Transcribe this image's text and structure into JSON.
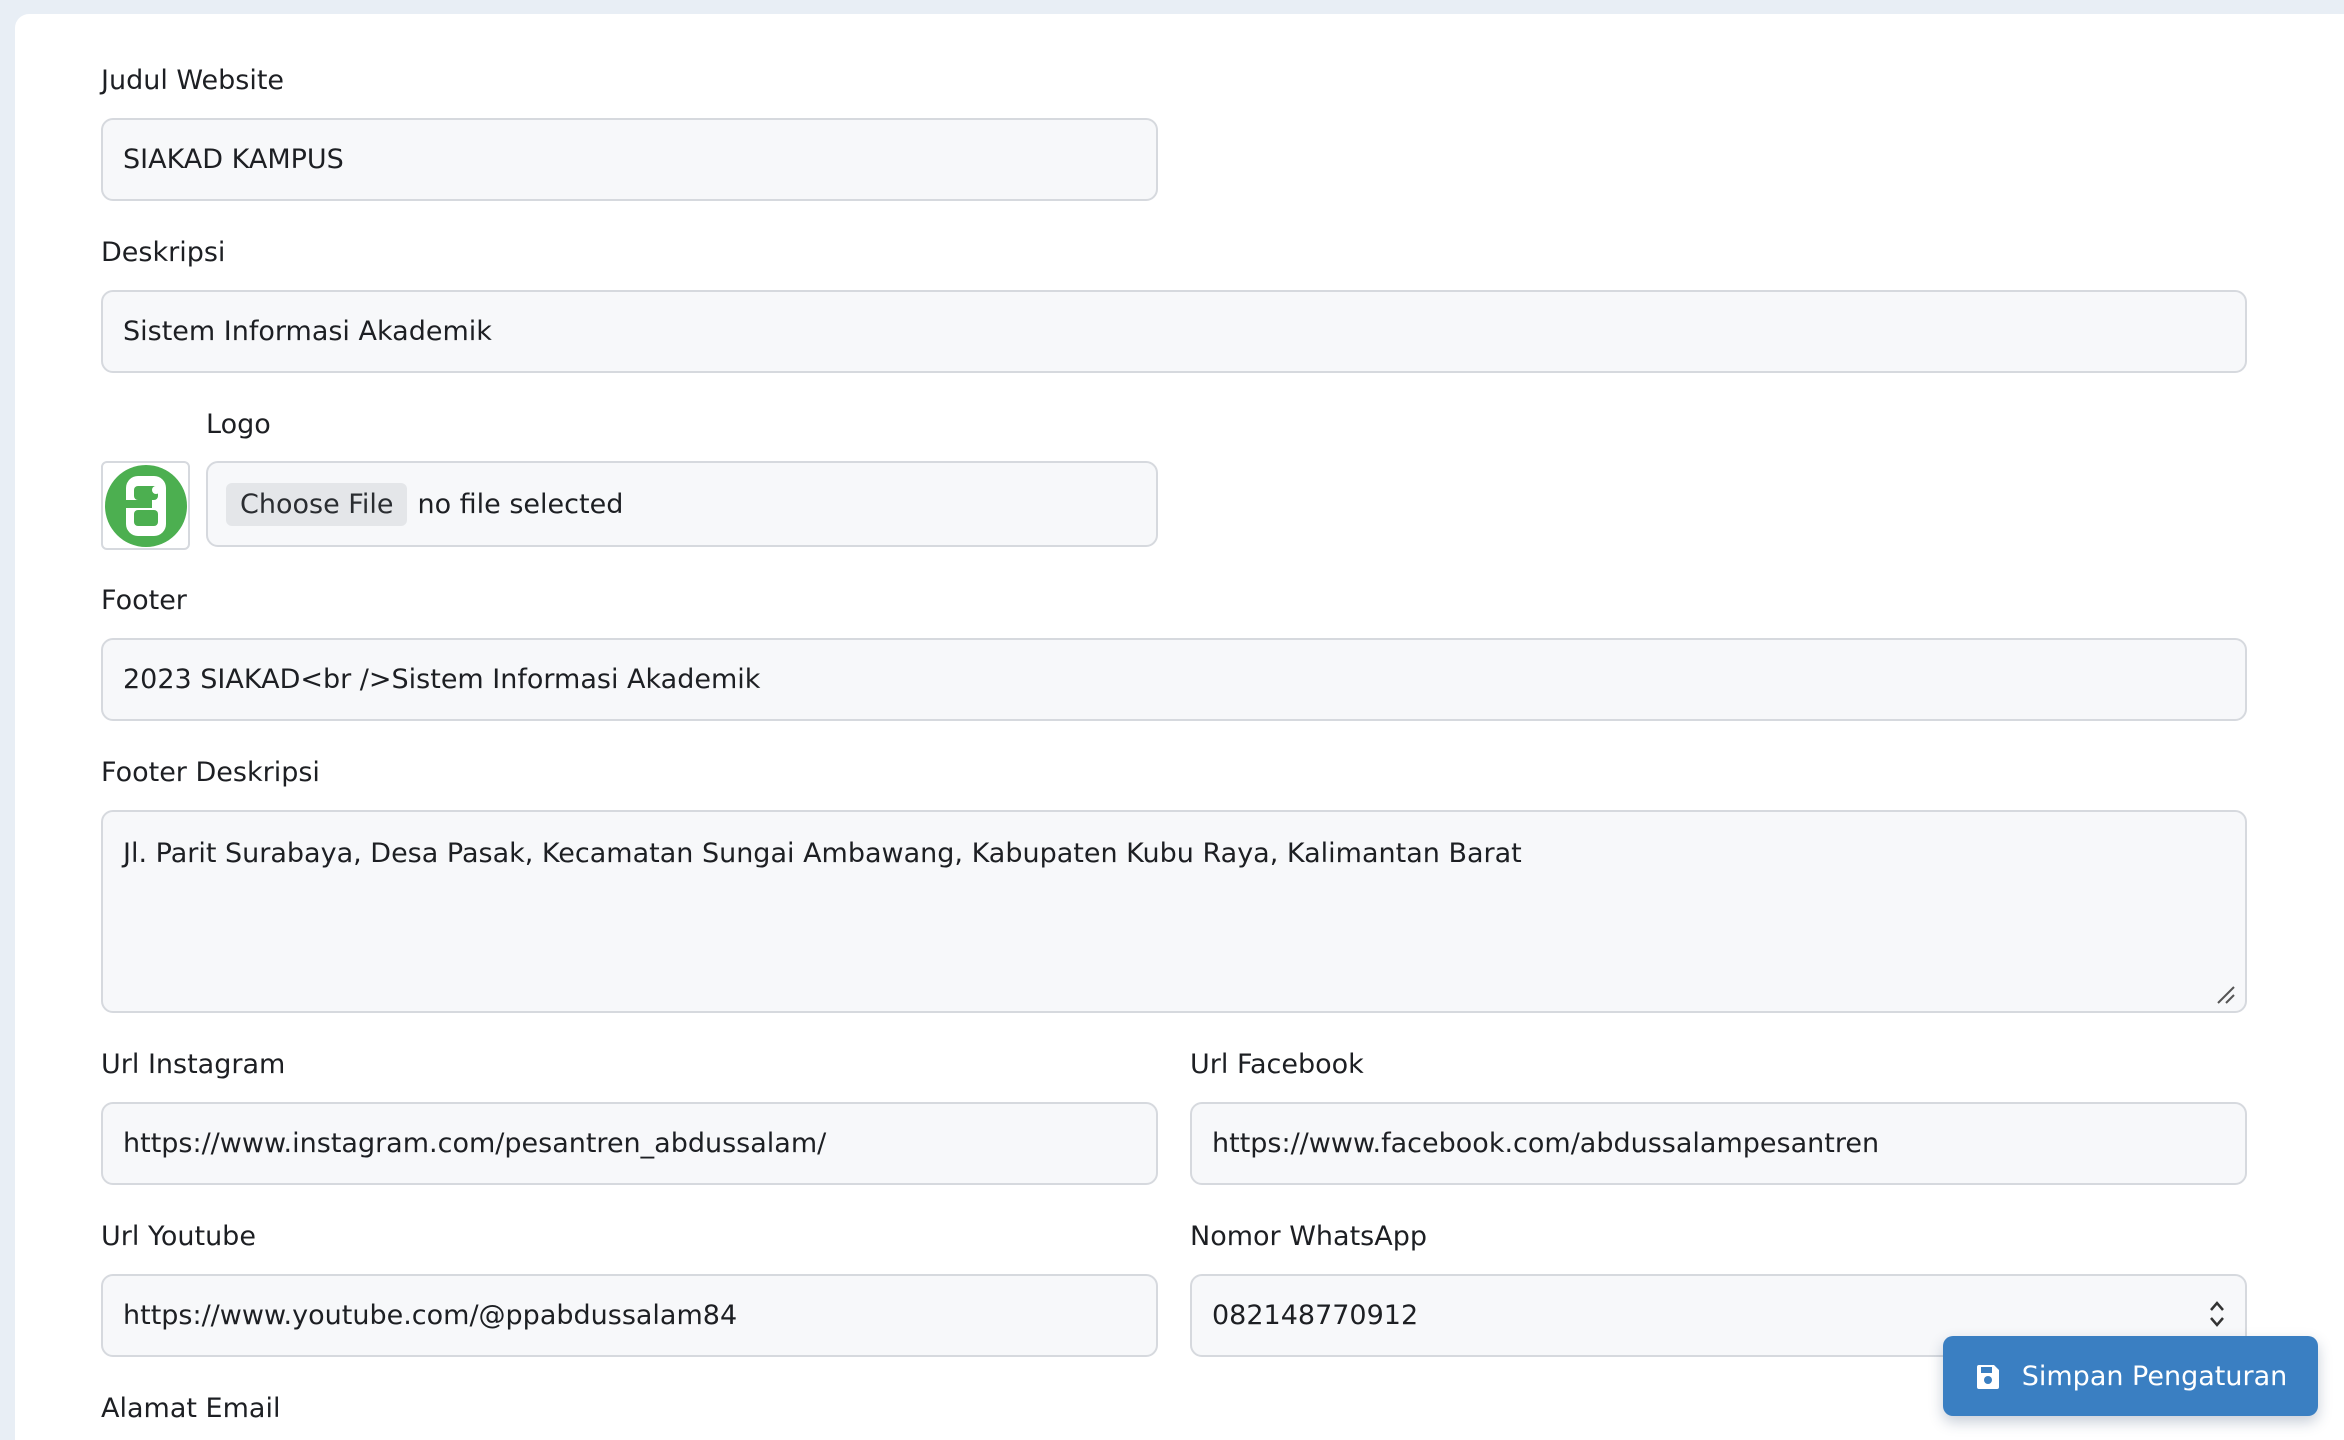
{
  "form": {
    "judul": {
      "label": "Judul Website",
      "value": "SIAKAD KAMPUS"
    },
    "deskripsi": {
      "label": "Deskripsi",
      "value": "Sistem Informasi Akademik"
    },
    "logo": {
      "label": "Logo",
      "button": "Choose File",
      "status": "no file selected",
      "icon": "logo-icon"
    },
    "footer": {
      "label": "Footer",
      "value": "2023 SIAKAD<br />Sistem Informasi Akademik"
    },
    "footer_deskripsi": {
      "label": "Footer Deskripsi",
      "value": "Jl. Parit Surabaya, Desa Pasak, Kecamatan Sungai Ambawang, Kabupaten Kubu Raya, Kalimantan Barat"
    },
    "instagram": {
      "label": "Url Instagram",
      "value": "https://www.instagram.com/pesantren_abdussalam/"
    },
    "facebook": {
      "label": "Url Facebook",
      "value": "https://www.facebook.com/abdussalampesantren"
    },
    "youtube": {
      "label": "Url Youtube",
      "value": "https://www.youtube.com/@ppabdussalam84"
    },
    "whatsapp": {
      "label": "Nomor WhatsApp",
      "value": "082148770912"
    },
    "email": {
      "label": "Alamat Email"
    }
  },
  "actions": {
    "save_label": "Simpan Pengaturan",
    "save_icon": "save-icon"
  },
  "colors": {
    "accent": "#3a7fc2",
    "logo_green": "#4caf50"
  }
}
